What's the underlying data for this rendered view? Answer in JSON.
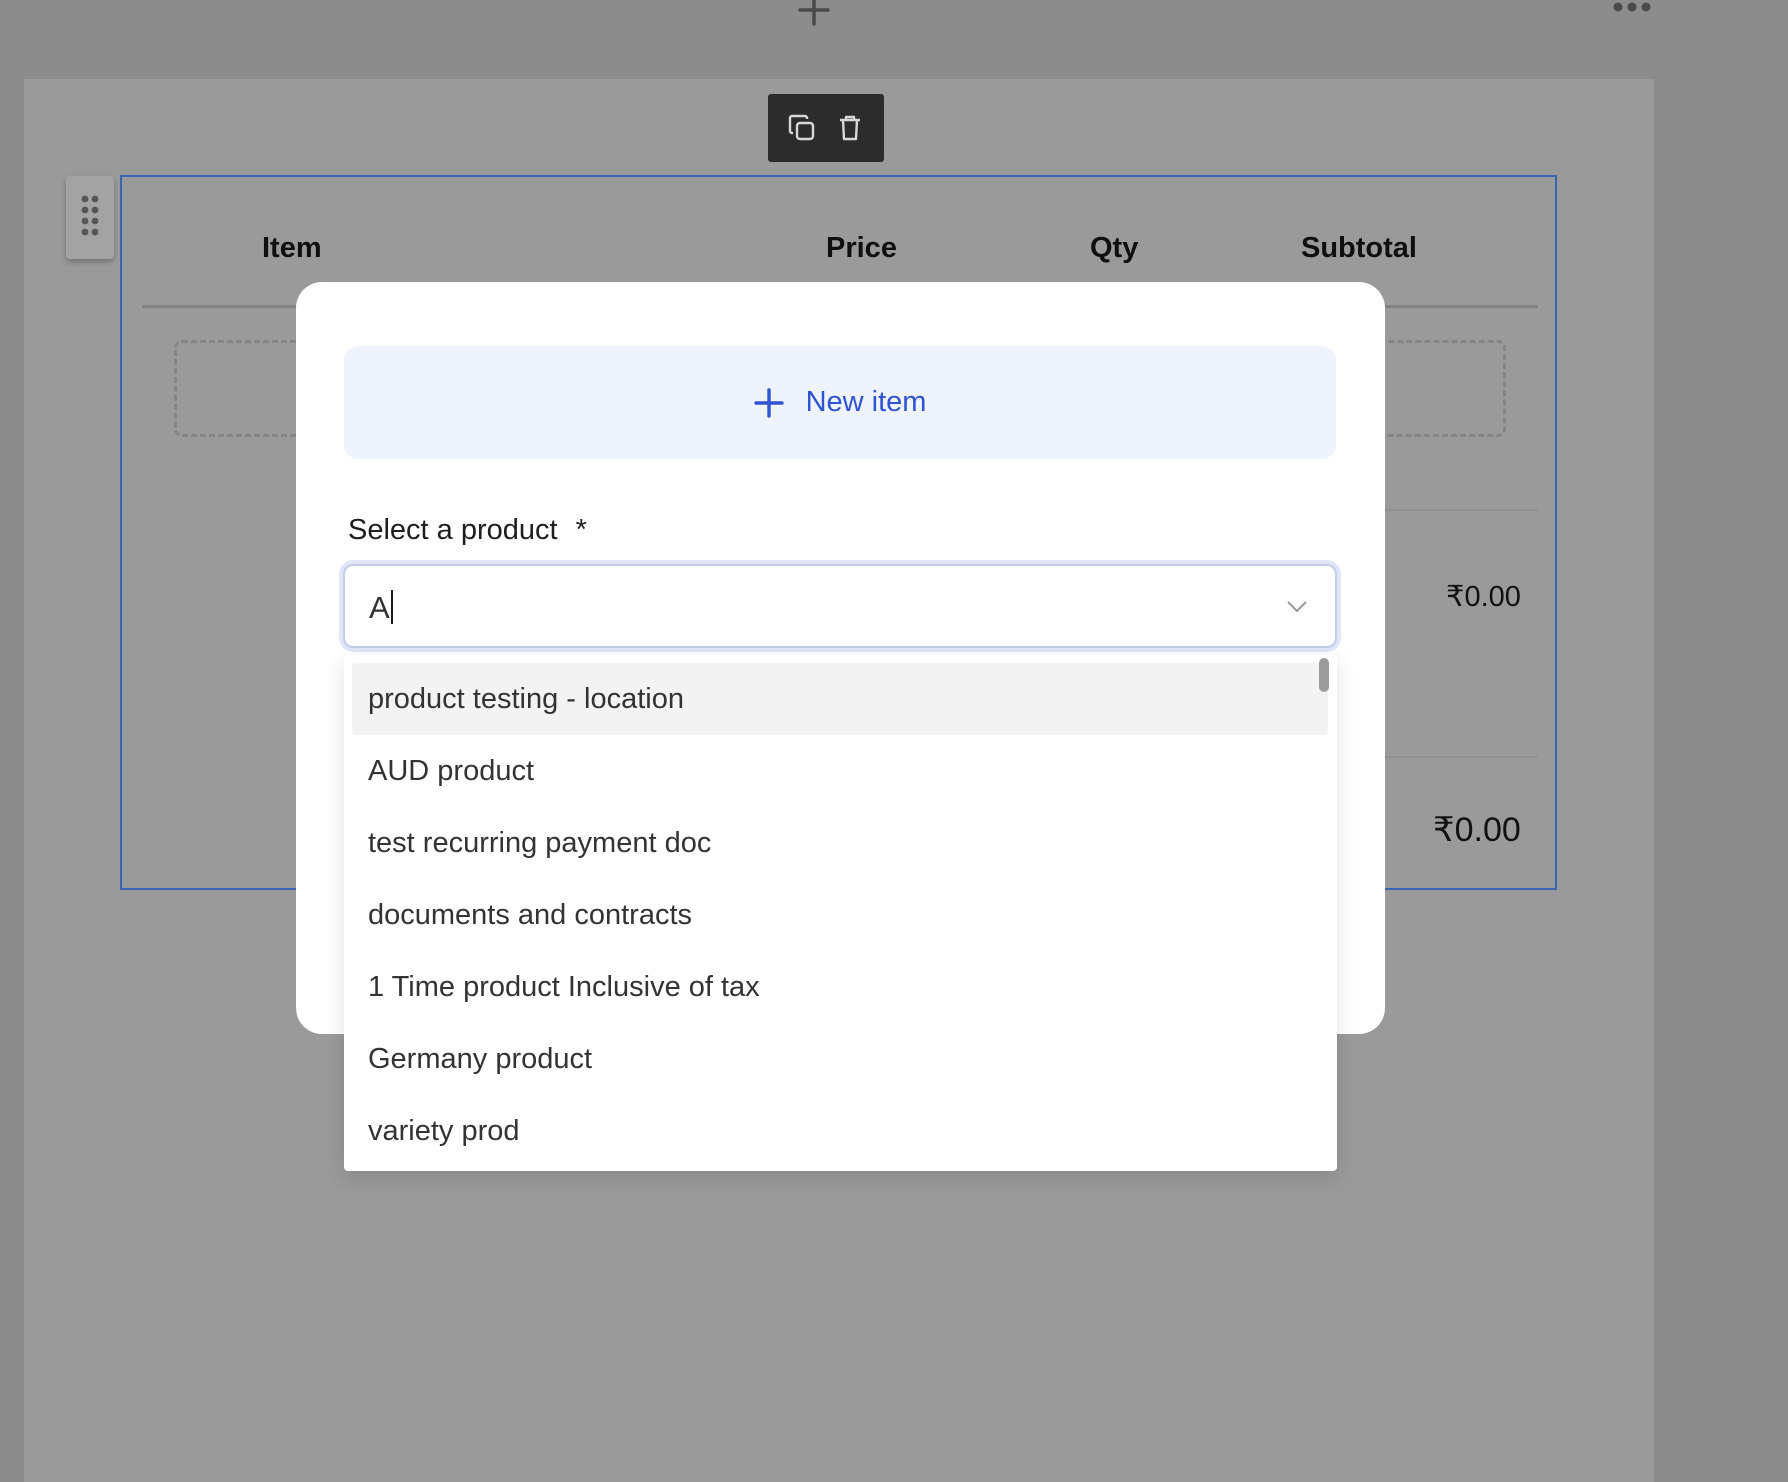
{
  "table": {
    "headers": {
      "item": "Item",
      "price": "Price",
      "qty": "Qty",
      "subtotal": "Subtotal"
    },
    "row_subtotal": "₹0.00",
    "grand_total": "₹0.00"
  },
  "modal": {
    "new_item_label": "New item",
    "field_label": "Select a product",
    "required_mark": "*",
    "input_value": "A"
  },
  "dropdown": {
    "options": [
      "product testing - location",
      "AUD product",
      "test recurring payment doc",
      "documents and contracts",
      "1 Time product Inclusive of tax",
      "Germany product",
      "variety prod"
    ],
    "highlighted_index": 0
  },
  "icons": {
    "add_block": "plus-icon",
    "more": "more-horizontal-icon",
    "duplicate": "copy-icon",
    "delete": "trash-icon",
    "drag": "drag-handle-icon",
    "new_item": "plus-icon",
    "dropdown": "chevron-down-icon"
  },
  "colors": {
    "accent": "#2f53d1",
    "block_border": "#3b64b4",
    "overlay": "#8c8c8c"
  }
}
